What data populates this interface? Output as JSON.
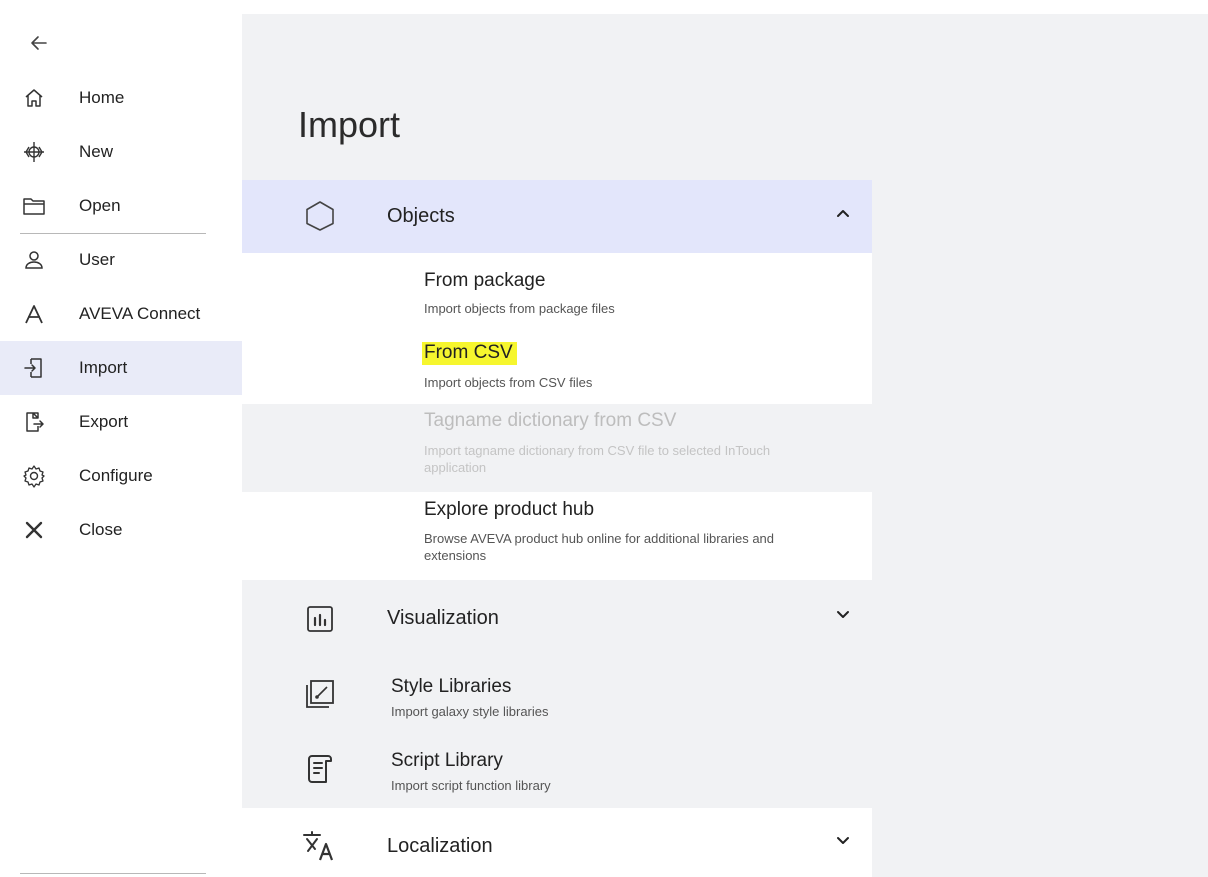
{
  "sidebar": {
    "items": [
      {
        "label": "Home",
        "icon": "home-icon"
      },
      {
        "label": "New",
        "icon": "new-icon"
      },
      {
        "label": "Open",
        "icon": "folder-open-icon"
      },
      {
        "label": "User",
        "icon": "user-icon"
      },
      {
        "label": "AVEVA Connect",
        "icon": "aveva-connect-icon"
      },
      {
        "label": "Import",
        "icon": "import-icon",
        "active": true
      },
      {
        "label": "Export",
        "icon": "export-icon"
      },
      {
        "label": "Configure",
        "icon": "gear-icon"
      },
      {
        "label": "Close",
        "icon": "close-icon"
      }
    ]
  },
  "page": {
    "title": "Import"
  },
  "objects": {
    "label": "Objects",
    "items": [
      {
        "title": "From package",
        "desc": "Import objects from package files"
      },
      {
        "title": "From CSV",
        "desc": "Import objects from CSV files",
        "highlighted": true
      },
      {
        "title": "Tagname dictionary from CSV",
        "desc": "Import tagname dictionary from CSV file to selected InTouch application",
        "disabled": true
      },
      {
        "title": "Explore product hub",
        "desc": "Browse AVEVA product hub online for additional libraries and extensions"
      }
    ]
  },
  "visualization": {
    "label": "Visualization",
    "items": [
      {
        "title": "Style Libraries",
        "desc": "Import galaxy style libraries",
        "icon": "style-library-icon"
      },
      {
        "title": "Script Library",
        "desc": "Import script function library",
        "icon": "script-library-icon"
      }
    ]
  },
  "localization": {
    "label": "Localization"
  },
  "colors": {
    "active_nav": "#e9ebf8",
    "expanded_header": "#e3e6fb",
    "pane_gray": "#f1f2f4",
    "highlight": "#f6f62e"
  }
}
